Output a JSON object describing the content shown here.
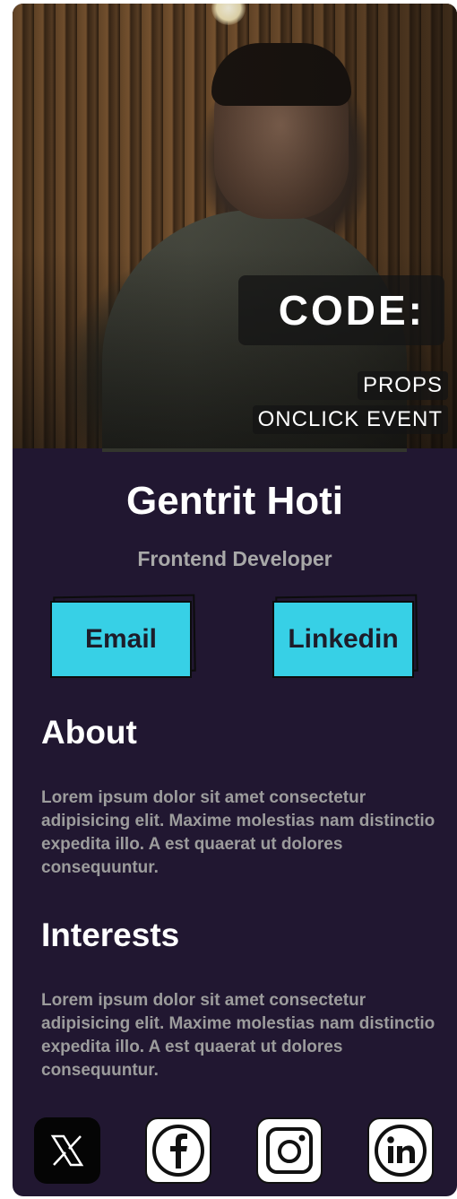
{
  "hero": {
    "badge_title": "CODE:",
    "badge_lines": [
      "PROPS",
      "ONCLICK EVENT"
    ]
  },
  "profile": {
    "name": "Gentrit Hoti",
    "role": "Frontend Developer"
  },
  "buttons": {
    "email_label": "Email",
    "linkedin_label": "Linkedin"
  },
  "about": {
    "title": "About",
    "body": "Lorem ipsum dolor sit amet consectetur adipisicing elit. Maxime molestias nam distinctio expedita illo. A est quaerat ut dolores consequuntur."
  },
  "interests": {
    "title": "Interests",
    "body": "Lorem ipsum dolor sit amet consectetur adipisicing elit. Maxime molestias nam distinctio expedita illo. A est quaerat ut dolores consequuntur."
  },
  "socials": [
    {
      "icon": "x-icon"
    },
    {
      "icon": "facebook-icon"
    },
    {
      "icon": "instagram-icon"
    },
    {
      "icon": "linkedin-icon"
    }
  ],
  "colors": {
    "card_bg": "#211731",
    "button_accent": "#37d0e6",
    "muted_text": "#9c9c9c"
  }
}
